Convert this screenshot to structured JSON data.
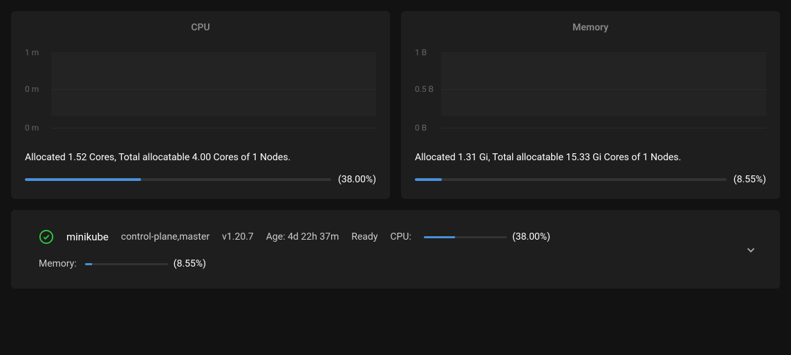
{
  "cpu_card": {
    "title": "CPU",
    "ylabels": [
      "1 m",
      "0 m",
      "0 m"
    ],
    "allocated_text": "Allocated 1.52 Cores, Total allocatable 4.00 Cores of 1 Nodes.",
    "percent_label": "(38.00%)",
    "percent": 38.0
  },
  "memory_card": {
    "title": "Memory",
    "ylabels": [
      "1 B",
      "0.5 B",
      "0 B"
    ],
    "allocated_text": "Allocated 1.31 Gi, Total allocatable 15.33 Gi Cores of 1 Nodes.",
    "percent_label": "(8.55%)",
    "percent": 8.55
  },
  "node": {
    "name": "minikube",
    "roles": "control-plane,master",
    "version": "v1.20.7",
    "age_label": "Age: 4d 22h 37m",
    "status": "Ready",
    "cpu_label": "CPU:",
    "cpu_percent_label": "(38.00%)",
    "cpu_percent": 38.0,
    "memory_label": "Memory:",
    "memory_percent_label": "(8.55%)",
    "memory_percent": 8.55
  },
  "chart_data": [
    {
      "type": "line",
      "title": "CPU",
      "ylabel": "",
      "ylim": [
        0,
        1
      ],
      "yunit": "m",
      "series": [
        {
          "name": "cpu",
          "values": []
        }
      ]
    },
    {
      "type": "line",
      "title": "Memory",
      "ylabel": "",
      "ylim": [
        0,
        1
      ],
      "yunit": "B",
      "series": [
        {
          "name": "memory",
          "values": []
        }
      ]
    }
  ]
}
